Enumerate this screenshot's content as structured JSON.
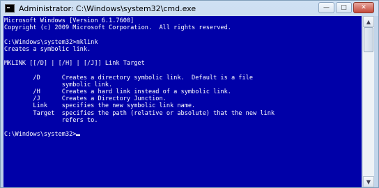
{
  "window": {
    "title": "Administrator: C:\\Windows\\system32\\cmd.exe",
    "controls": {
      "minimize": "—",
      "maximize": "□",
      "close": "✕"
    }
  },
  "console": {
    "lines": [
      "Microsoft Windows [Version 6.1.7600]",
      "Copyright (c) 2009 Microsoft Corporation.  All rights reserved.",
      "",
      "C:\\Windows\\system32>mklink",
      "Creates a symbolic link.",
      "",
      "MKLINK [[/D] | [/H] | [/J]] Link Target",
      "",
      "        /D      Creates a directory symbolic link.  Default is a file",
      "                symbolic link.",
      "        /H      Creates a hard link instead of a symbolic link.",
      "        /J      Creates a Directory Junction.",
      "        Link    specifies the new symbolic link name.",
      "        Target  specifies the path (relative or absolute) that the new link",
      "                refers to.",
      "",
      "C:\\Windows\\system32>"
    ],
    "colors": {
      "background": "#0000a8",
      "foreground": "#ffffff"
    }
  },
  "scrollbar": {
    "up_arrow": "▲",
    "down_arrow": "▼"
  }
}
